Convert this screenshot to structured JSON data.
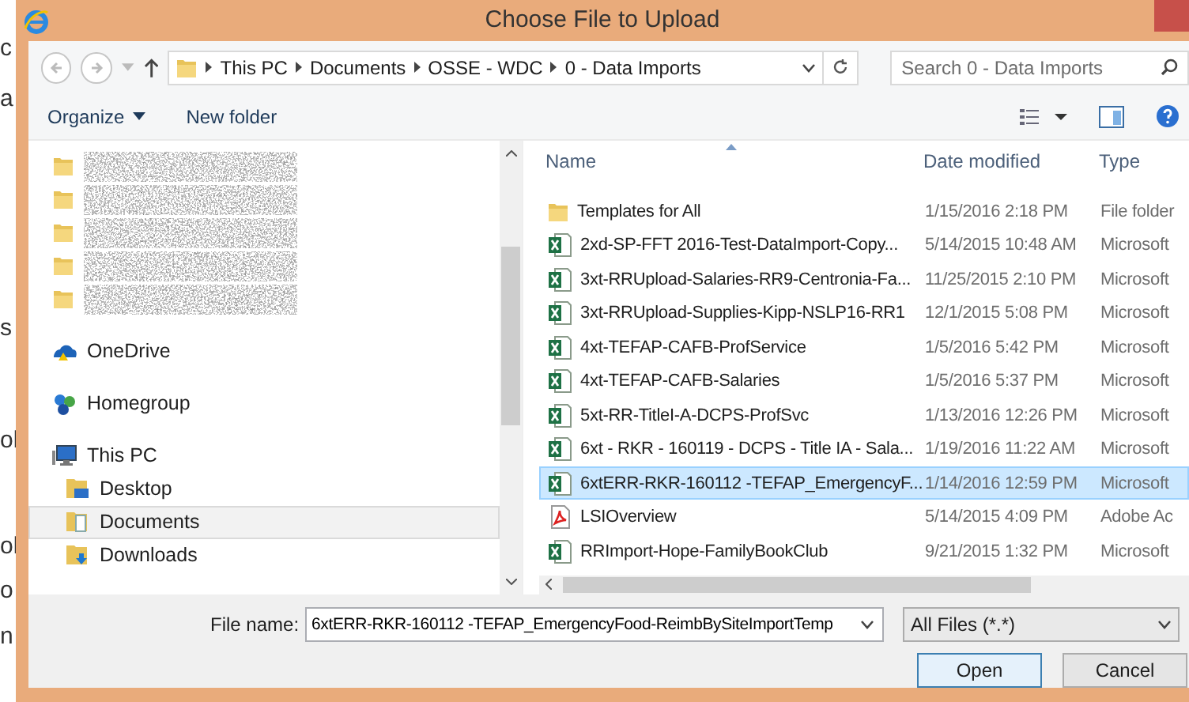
{
  "background_page": {
    "fragments": [
      "c",
      "a",
      "s",
      "ol",
      "ol",
      "o",
      "n"
    ]
  },
  "window": {
    "title": "Choose File to Upload"
  },
  "address_bar": {
    "path": [
      "This PC",
      "Documents",
      "OSSE - WDC",
      "0 - Data Imports"
    ]
  },
  "search": {
    "placeholder": "Search 0 - Data Imports"
  },
  "toolbar": {
    "organize": "Organize",
    "new_folder": "New folder"
  },
  "navigation": {
    "items": [
      {
        "kind": "redacted",
        "selected": false
      },
      {
        "kind": "redacted",
        "selected": false
      },
      {
        "kind": "redacted",
        "selected": false
      },
      {
        "kind": "redacted",
        "selected": false
      },
      {
        "kind": "redacted",
        "selected": false
      },
      {
        "kind": "cloud",
        "label": "OneDrive",
        "selected": false
      },
      {
        "kind": "homegroup",
        "label": "Homegroup",
        "selected": false
      },
      {
        "kind": "pc",
        "label": "This PC",
        "selected": false,
        "children": [
          {
            "kind": "desktop",
            "label": "Desktop",
            "selected": false
          },
          {
            "kind": "documents",
            "label": "Documents",
            "selected": true
          },
          {
            "kind": "downloads",
            "label": "Downloads",
            "selected": false
          }
        ]
      }
    ]
  },
  "files": {
    "columns": [
      "Name",
      "Date modified",
      "Type"
    ],
    "rows": [
      {
        "kind": "folder",
        "name": "Templates for All",
        "date": "1/15/2016 2:18 PM",
        "type": "File folder",
        "selected": false
      },
      {
        "kind": "excel",
        "name": "2xd-SP-FFT 2016-Test-DataImport-Copy...",
        "date": "5/14/2015 10:48 AM",
        "type": "Microsoft",
        "selected": false
      },
      {
        "kind": "excel",
        "name": "3xt-RRUpload-Salaries-RR9-Centronia-Fa...",
        "date": "11/25/2015 2:10 PM",
        "type": "Microsoft",
        "selected": false
      },
      {
        "kind": "excel",
        "name": "3xt-RRUpload-Supplies-Kipp-NSLP16-RR1",
        "date": "12/1/2015 5:08 PM",
        "type": "Microsoft",
        "selected": false
      },
      {
        "kind": "excel",
        "name": "4xt-TEFAP-CAFB-ProfService",
        "date": "1/5/2016 5:42 PM",
        "type": "Microsoft",
        "selected": false
      },
      {
        "kind": "excel",
        "name": "4xt-TEFAP-CAFB-Salaries",
        "date": "1/5/2016 5:37 PM",
        "type": "Microsoft",
        "selected": false
      },
      {
        "kind": "excel",
        "name": "5xt-RR-TitleI-A-DCPS-ProfSvc",
        "date": "1/13/2016 12:26 PM",
        "type": "Microsoft",
        "selected": false
      },
      {
        "kind": "excel",
        "name": "6xt - RKR - 160119 - DCPS - Title IA - Sala...",
        "date": "1/19/2016 11:22 AM",
        "type": "Microsoft",
        "selected": false
      },
      {
        "kind": "excel",
        "name": "6xtERR-RKR-160112 -TEFAP_EmergencyF...",
        "date": "1/14/2016 12:59 PM",
        "type": "Microsoft",
        "selected": true
      },
      {
        "kind": "pdf",
        "name": "LSIOverview",
        "date": "5/14/2015 4:09 PM",
        "type": "Adobe Ac",
        "selected": false
      },
      {
        "kind": "excel",
        "name": "RRImport-Hope-FamilyBookClub",
        "date": "9/21/2015 1:32 PM",
        "type": "Microsoft",
        "selected": false
      }
    ]
  },
  "file_name": {
    "label": "File name:",
    "value": "6xtERR-RKR-160112 -TEFAP_EmergencyFood-ReimbBySiteImportTemp"
  },
  "file_type": {
    "value": "All Files (*.*)"
  },
  "buttons": [
    {
      "label": "Open",
      "default": true
    },
    {
      "label": "Cancel",
      "default": false
    }
  ]
}
